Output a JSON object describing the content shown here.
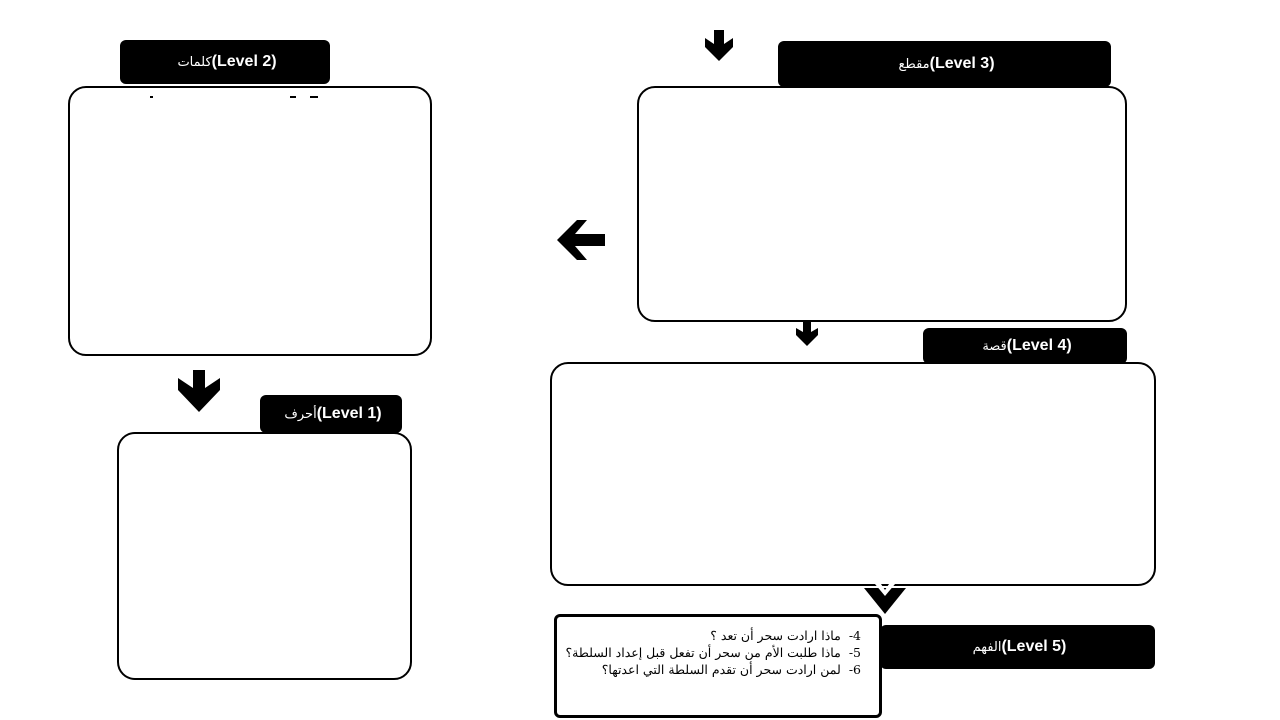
{
  "levels": {
    "level2": {
      "label_en": "(Level 2)",
      "label_ar": "كلمات"
    },
    "level3": {
      "label_en": "(Level 3)",
      "label_ar": "مقطع"
    },
    "level1": {
      "label_en": "(Level 1)",
      "label_ar": "أحرف"
    },
    "level4": {
      "label_en": "(Level 4)",
      "label_ar": "قصة"
    },
    "level5": {
      "label_en": "(Level 5)",
      "label_ar": "الفهم"
    }
  },
  "questions": [
    {
      "num": "4-",
      "text": "ماذا ارادت سحر أن تعد ؟"
    },
    {
      "num": "5-",
      "text": "ماذا طلبت الأم من سحر أن تفعل قبل إعداد السلطة؟"
    },
    {
      "num": "6-",
      "text": "لمن ارادت سحر أن تقدم السلطة التي اعدتها؟"
    }
  ],
  "colors": {
    "header_bg": "#000000",
    "header_text": "#ffffff",
    "border": "#000000"
  },
  "icons": [
    "arrow-down-icon",
    "arrow-left-icon"
  ]
}
